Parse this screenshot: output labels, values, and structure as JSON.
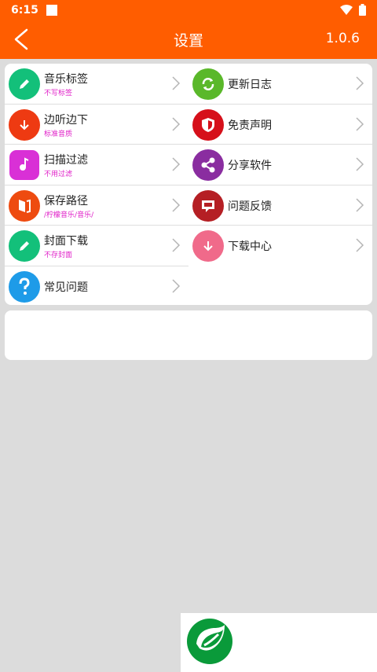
{
  "status": {
    "time": "6:15"
  },
  "header": {
    "title": "设置",
    "version": "1.0.6"
  },
  "left_items": [
    {
      "label": "音乐标签",
      "sub": "不写标签",
      "icon": "pencil-icon",
      "color": "#13c07a"
    },
    {
      "label": "边听边下",
      "sub": "标准音质",
      "icon": "download-arrow-icon",
      "color": "#ee3a12"
    },
    {
      "label": "扫描过滤",
      "sub": "不用过滤",
      "icon": "music-note-icon",
      "color": "#d930d6"
    },
    {
      "label": "保存路径",
      "sub": "/柠檬音乐/音乐/",
      "icon": "folder-path-icon",
      "color": "#ee4b10"
    },
    {
      "label": "封面下载",
      "sub": "不存封面",
      "icon": "pencil-icon",
      "color": "#13c07a"
    },
    {
      "label": "常见问题",
      "sub": "",
      "icon": "question-icon",
      "color": "#1e9be8"
    }
  ],
  "right_items": [
    {
      "label": "更新日志",
      "icon": "refresh-icon",
      "color": "#5ab82a"
    },
    {
      "label": "免责声明",
      "icon": "shield-icon",
      "color": "#d6101a"
    },
    {
      "label": "分享软件",
      "icon": "share-icon",
      "color": "#8a2da0"
    },
    {
      "label": "问题反馈",
      "icon": "feedback-icon",
      "color": "#b51f24"
    },
    {
      "label": "下载中心",
      "icon": "download-arrow-icon",
      "color": "#f06a8a"
    }
  ],
  "colors": {
    "accent": "#ff5d00",
    "sub_text": "#e020c8",
    "background": "#dcdcdc"
  }
}
